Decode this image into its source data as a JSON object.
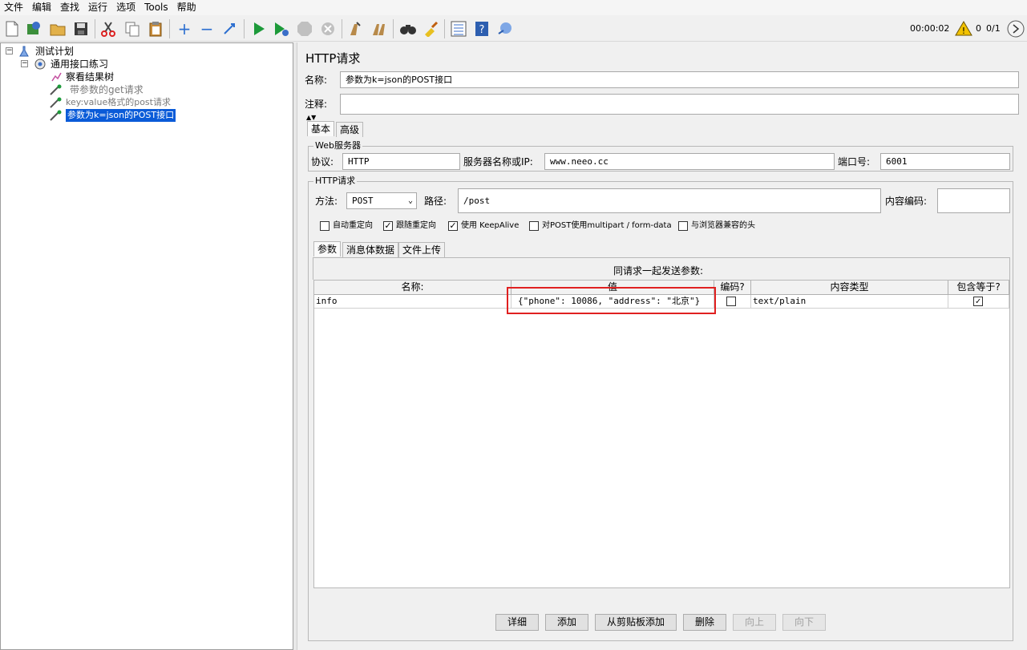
{
  "menu": [
    "文件",
    "编辑",
    "查找",
    "运行",
    "选项",
    "Tools",
    "帮助"
  ],
  "toolbar": {
    "icons": [
      "new-icon",
      "templates-icon",
      "open-icon",
      "save-icon",
      "cut-icon",
      "copy-icon",
      "paste-icon",
      "expand-icon",
      "collapse-icon",
      "toggle-icon",
      "start-icon",
      "start-no-pause-icon",
      "stop-icon",
      "shutdown-icon",
      "clear-icon",
      "clear-all-icon",
      "search-icon",
      "reset-search-icon",
      "function-helper-icon",
      "help-icon",
      "remote-icon"
    ],
    "timer": "00:00:02",
    "warning_count": "0",
    "threads": "0/1"
  },
  "tree": {
    "nodes": [
      {
        "label": "测试计划",
        "icon": "test-plan-icon"
      },
      {
        "label": "通用接口练习",
        "icon": "thread-group-icon"
      },
      {
        "label": "察看结果树",
        "icon": "result-tree-icon"
      },
      {
        "label": "带参数的get请求",
        "icon": "sampler-icon"
      },
      {
        "label": "key:value格式的post请求",
        "icon": "sampler-icon"
      },
      {
        "label": "参数为k=json的POST接口",
        "icon": "sampler-icon"
      }
    ]
  },
  "panel": {
    "title": "HTTP请求",
    "name_label": "名称:",
    "name_value": "参数为k=json的POST接口",
    "comment_label": "注释:",
    "comment_value": "",
    "tabs": [
      "基本",
      "高级"
    ],
    "web_server": {
      "group_label": "Web服务器",
      "protocol_label": "协议:",
      "protocol_value": "HTTP",
      "server_label": "服务器名称或IP:",
      "server_value": "www.neeo.cc",
      "port_label": "端口号:",
      "port_value": "6001"
    },
    "http_request": {
      "group_label": "HTTP请求",
      "method_label": "方法:",
      "method_value": "POST",
      "path_label": "路径:",
      "path_value": "/post",
      "encoding_label": "内容编码:",
      "encoding_value": "",
      "checkboxes": [
        {
          "label": "自动重定向",
          "checked": false
        },
        {
          "label": "跟随重定向",
          "checked": true
        },
        {
          "label": "使用 KeepAlive",
          "checked": true
        },
        {
          "label": "对POST使用multipart / form-data",
          "checked": false
        },
        {
          "label": "与浏览器兼容的头",
          "checked": false
        }
      ]
    },
    "subtabs": [
      "参数",
      "消息体数据",
      "文件上传"
    ],
    "params": {
      "caption": "同请求一起发送参数:",
      "headers": [
        "名称:",
        "值",
        "编码?",
        "内容类型",
        "包含等于?"
      ],
      "rows": [
        {
          "name": "info",
          "value": "{\"phone\": 10086, \"address\": \"北京\"}",
          "encode": false,
          "content_type": "text/plain",
          "include_equals": true
        }
      ]
    },
    "buttons": [
      {
        "label": "详细",
        "enabled": true
      },
      {
        "label": "添加",
        "enabled": true
      },
      {
        "label": "从剪贴板添加",
        "enabled": true
      },
      {
        "label": "删除",
        "enabled": true
      },
      {
        "label": "向上",
        "enabled": false
      },
      {
        "label": "向下",
        "enabled": false
      }
    ],
    "highlight_color": "#e02020"
  }
}
